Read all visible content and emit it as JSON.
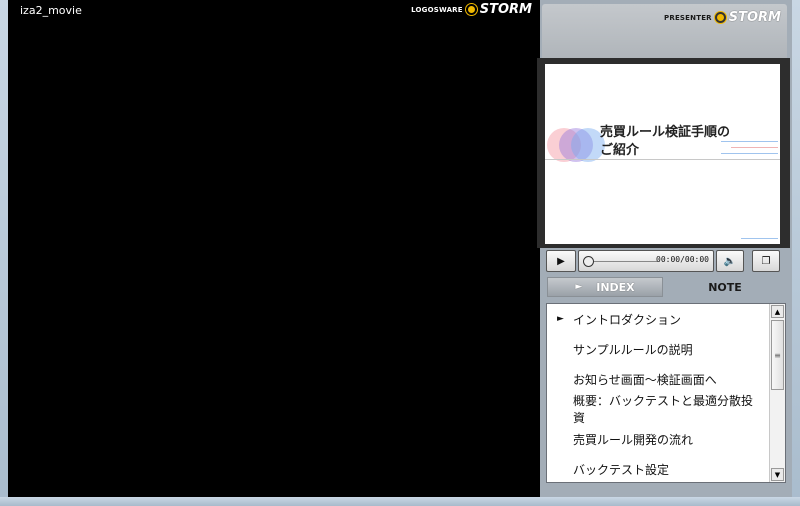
{
  "video": {
    "title": "iza2_movie",
    "logo_small": "LOGOSWARE",
    "logo_big": "STORM"
  },
  "presenter": {
    "logo_small": "PRESENTER",
    "logo_big": "STORM"
  },
  "slide": {
    "title_line1": "売買ルール検証手順の",
    "title_line2": "ご紹介"
  },
  "controls": {
    "play_icon": "▶",
    "time": "00:00/00:00",
    "volume_icon": "🔈",
    "window_icon": "❐"
  },
  "tabs": [
    {
      "label": "INDEX",
      "arrow": "►",
      "active": true
    },
    {
      "label": "NOTE",
      "active": false
    }
  ],
  "index": {
    "items": [
      {
        "label": "イントロダクション",
        "current": true,
        "mark": "►"
      },
      {
        "label": "サンプルルールの説明",
        "current": false
      },
      {
        "label": "お知らせ画面～検証画面へ",
        "current": false
      },
      {
        "label": "概要：バックテストと最適分散投資",
        "current": false
      },
      {
        "label": "売買ルール開発の流れ",
        "current": false
      },
      {
        "label": "バックテスト設定",
        "current": false
      }
    ]
  },
  "scrollbar": {
    "up": "▲",
    "down": "▼",
    "grip": "≡"
  },
  "colors": {
    "storm_yellow": "#f0b800",
    "panel_gray": "#a3adb7"
  }
}
